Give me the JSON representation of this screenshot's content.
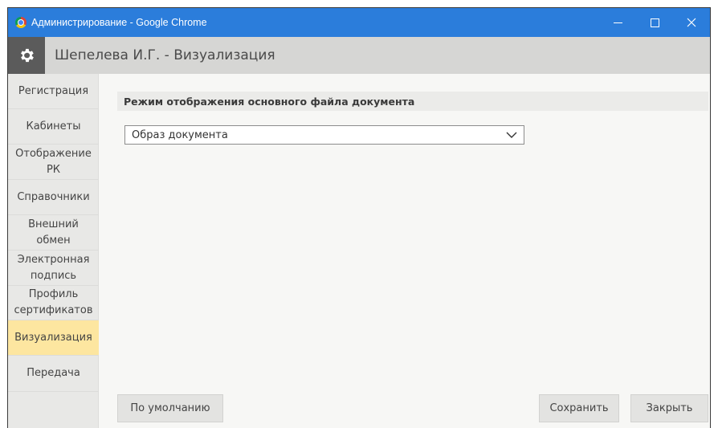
{
  "window": {
    "title": "Администрирование - Google Chrome",
    "accent": "#2b7ddb"
  },
  "header": {
    "title": "Шепелева И.Г. - Визуализация",
    "icon": "gear-icon"
  },
  "sidebar": {
    "items": [
      {
        "label": "Регистрация",
        "active": false
      },
      {
        "label": "Кабинеты",
        "active": false
      },
      {
        "label": "Отображение\nРК",
        "active": false
      },
      {
        "label": "Справочники",
        "active": false
      },
      {
        "label": "Внешний\nобмен",
        "active": false
      },
      {
        "label": "Электронная\nподпись",
        "active": false
      },
      {
        "label": "Профиль\nсертификатов",
        "active": false
      },
      {
        "label": "Визуализация",
        "active": true
      },
      {
        "label": "Передача",
        "active": false
      }
    ],
    "active_color": "#fde6a0"
  },
  "main": {
    "section_title": "Режим отображения основного файла документа",
    "display_mode": {
      "value": "Образ документа"
    }
  },
  "footer": {
    "default_label": "По умолчанию",
    "save_label": "Сохранить",
    "close_label": "Закрыть"
  }
}
